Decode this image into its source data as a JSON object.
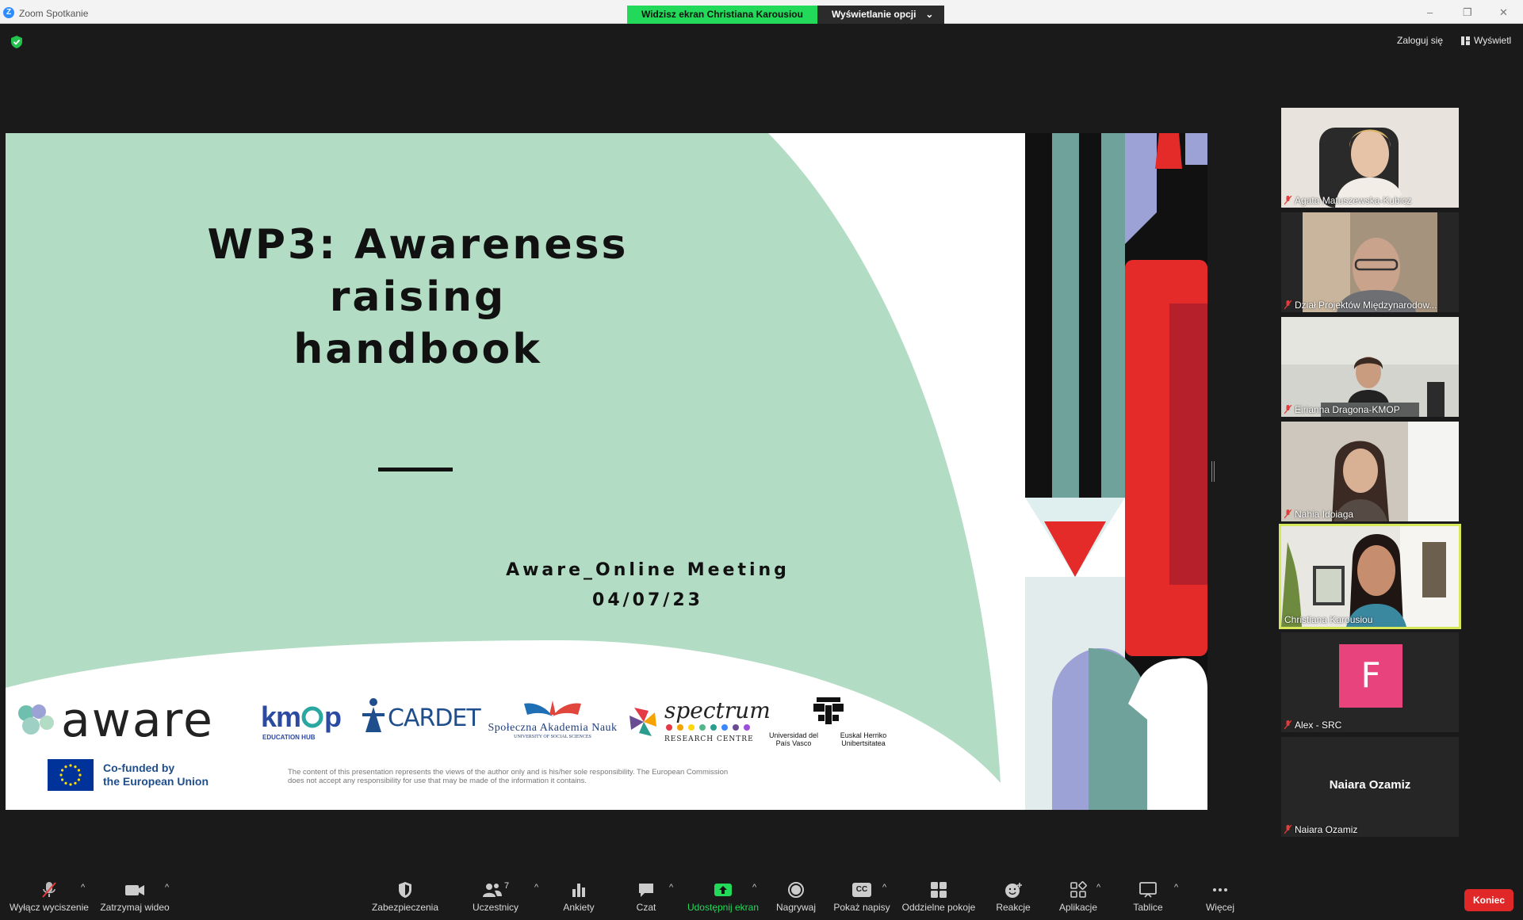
{
  "window": {
    "title": "Zoom Spotkanie",
    "share_banner": "Widzisz ekran Christiana Karousiou",
    "view_options": "Wyświetlanie opcji",
    "minimize": "–",
    "restore": "❐",
    "close": "✕"
  },
  "header": {
    "login": "Zaloguj się",
    "view": "Wyświetl"
  },
  "slide": {
    "title_line1": "WP3: Awareness raising",
    "title_line2": "handbook",
    "meeting_name": "Aware_Online Meeting",
    "meeting_date": "04/07/23",
    "logos": {
      "aware": "aware",
      "kmop": "km",
      "kmop_p": "p",
      "kmop_sub": "EDUCATION HUB",
      "cardet": "CARDET",
      "san": "Społeczna Akademia Nauk",
      "san_sub": "UNIVERSITY OF SOCIAL SCIENCES",
      "spectrum": "spectrum",
      "spectrum_sub": "RESEARCH CENTRE",
      "upv_left": "Universidad del País Vasco",
      "upv_right": "Euskal Herriko Unibertsitatea"
    },
    "eu_text_line1": "Co-funded by",
    "eu_text_line2": "the European Union",
    "disclaimer": "The content of this presentation represents the views of the author only and is his/her sole responsibility. The European Commission does not accept any responsibility for use that may be made of the information it contains."
  },
  "participants": [
    {
      "name": "Agata Matuszewska-Kubicz",
      "muted": true,
      "video": true
    },
    {
      "name": "Dział Projektów Międzynarodow...",
      "muted": true,
      "video": true
    },
    {
      "name": "Eirianna Dragona-KMOP",
      "muted": true,
      "video": true
    },
    {
      "name": "Nahia Idoiaga",
      "muted": true,
      "video": true
    },
    {
      "name": "Christiana Karousiou",
      "muted": false,
      "video": true,
      "active_speaker": true
    },
    {
      "name": "Alex - SRC",
      "muted": true,
      "video": false,
      "avatar_letter": "F",
      "avatar_color": "#e8437d"
    },
    {
      "name": "Naiara Ozamiz",
      "muted": true,
      "video": false,
      "center_label": "Naiara Ozamiz"
    }
  ],
  "toolbar": {
    "mute": "Wyłącz wyciszenie",
    "video": "Zatrzymaj wideo",
    "security": "Zabezpieczenia",
    "participants": "Uczestnicy",
    "participants_count": "7",
    "polls": "Ankiety",
    "chat": "Czat",
    "share": "Udostępnij ekran",
    "record": "Nagrywaj",
    "captions": "Pokaż napisy",
    "captions_badge": "CC",
    "breakout": "Oddzielne pokoje",
    "reactions": "Reakcje",
    "apps": "Aplikacje",
    "whiteboards": "Tablice",
    "more": "Więcej",
    "end": "Koniec"
  },
  "colors": {
    "share_green": "#23d959",
    "slide_mint": "#b2dcc4",
    "slide_red": "#e52a2a",
    "active_border": "#d7e75a",
    "end_red": "#e02828"
  }
}
